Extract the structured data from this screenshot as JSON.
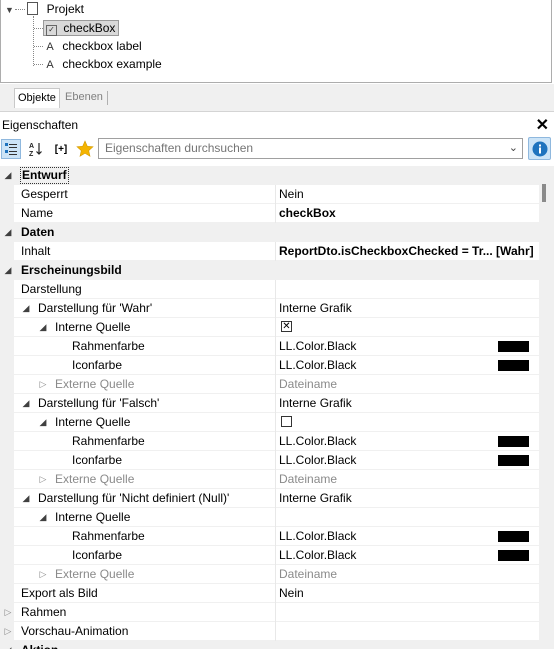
{
  "tree": {
    "root": "Projekt",
    "selected": "checkBox",
    "children": [
      "checkbox label",
      "checkbox example"
    ],
    "letter_glyph": "A"
  },
  "tabs": [
    "Objekte",
    "Ebenen"
  ],
  "panel": {
    "title": "Eigenschaften",
    "close": "✕"
  },
  "toolbar": {
    "search_placeholder": "Eigenschaften durchsuchen",
    "bracket_label": "[+]"
  },
  "grid": {
    "entwurf": "Entwurf",
    "gesperrt": "Gesperrt",
    "gesperrt_val": "Nein",
    "name": "Name",
    "name_val": "checkBox",
    "daten": "Daten",
    "inhalt": "Inhalt",
    "inhalt_val": "ReportDto.isCheckboxChecked = Tr... [Wahr]",
    "erscheinungsbild": "Erscheinungsbild",
    "darstellung": "Darstellung",
    "wahr": "Darstellung für 'Wahr'",
    "wahr_val": "Interne Grafik",
    "interne_quelle": "Interne Quelle",
    "rahmenfarbe": "Rahmenfarbe",
    "iconfarbe": "Iconfarbe",
    "color_val": "LL.Color.Black",
    "externe_quelle": "Externe Quelle",
    "dateiname": "Dateiname",
    "falsch": "Darstellung für 'Falsch'",
    "falsch_val": "Interne Grafik",
    "null": "Darstellung für 'Nicht definiert (Null)'",
    "null_val": "Interne Grafik",
    "export": "Export als Bild",
    "export_val": "Nein",
    "rahmen": "Rahmen",
    "vorschau": "Vorschau-Animation",
    "aktion": "Aktion"
  },
  "colors": {
    "swatch": "#000000",
    "info_accent": "#1e73be",
    "star": "#f4b400"
  }
}
